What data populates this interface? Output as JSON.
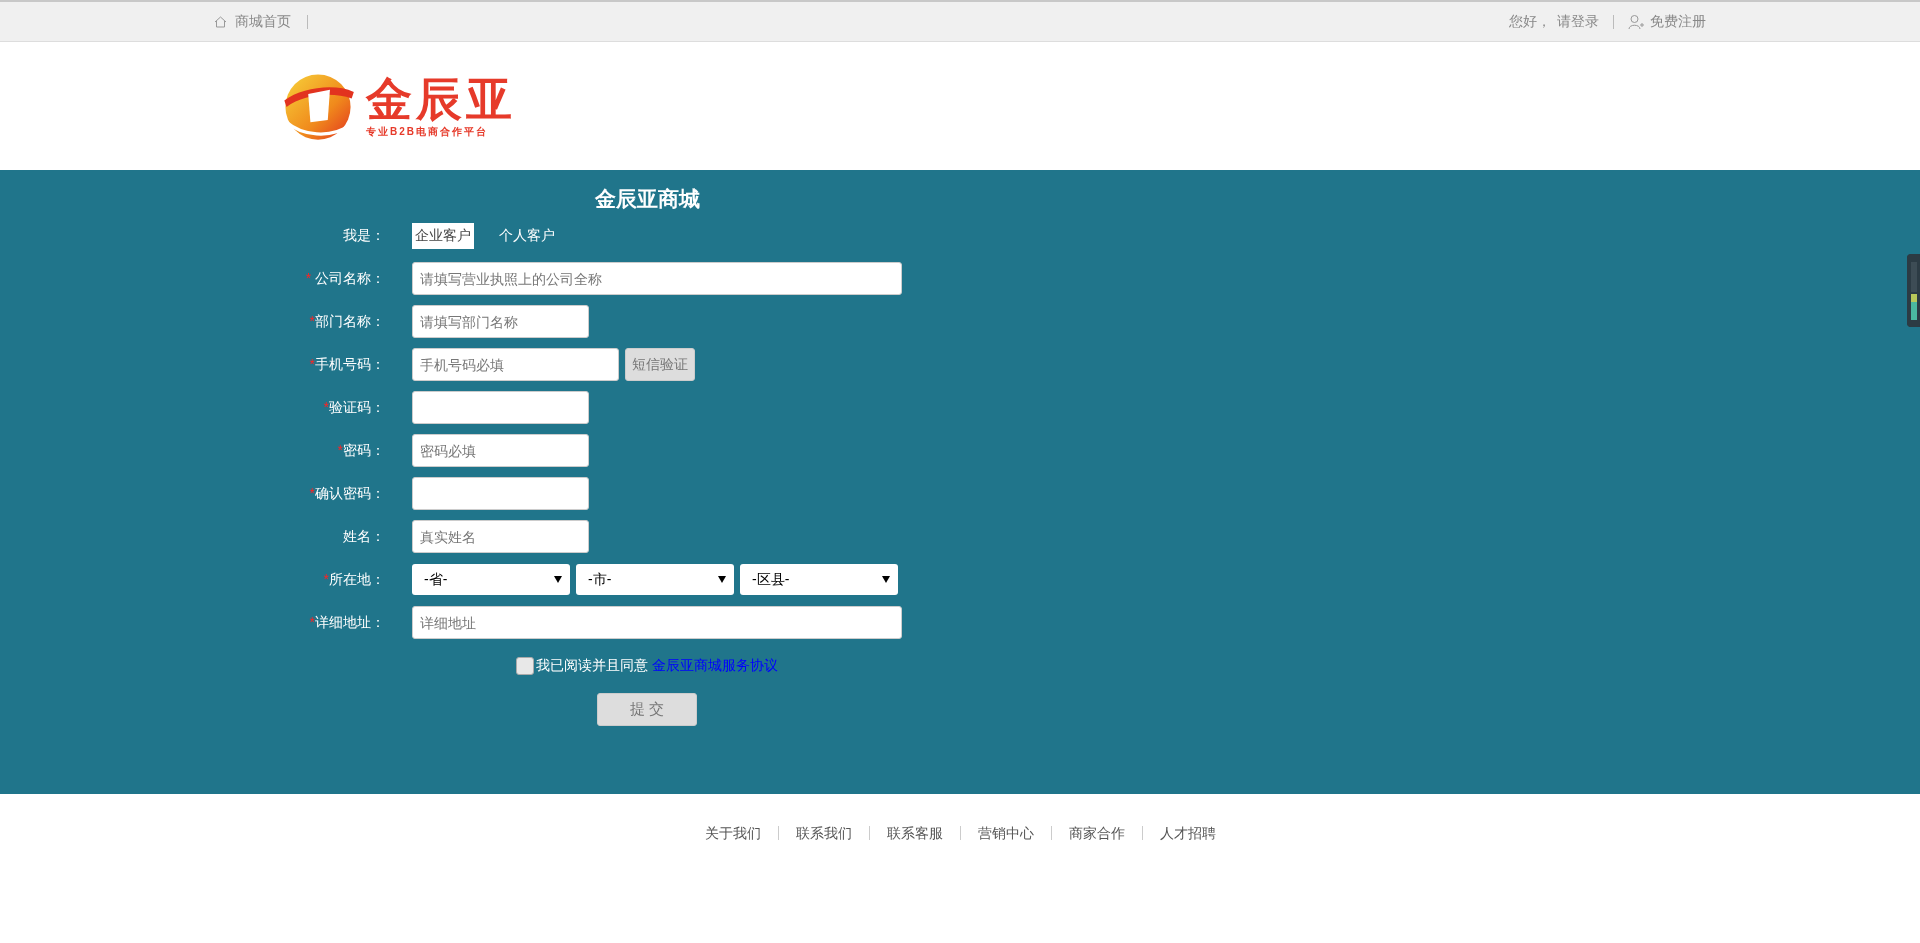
{
  "top_bar": {
    "home_link": "商城首页",
    "greeting": "您好，",
    "login_link": "请登录",
    "register_link": "免费注册"
  },
  "logo": {
    "name": "金辰亚",
    "tagline": "专业B2B电商合作平台"
  },
  "form": {
    "title": "金辰亚商城",
    "customer_type": {
      "label": "我是：",
      "options": [
        {
          "label": "企业客户",
          "selected": true
        },
        {
          "label": "个人客户",
          "selected": false
        }
      ]
    },
    "fields": [
      {
        "kind": "text_wide",
        "marker": "* ",
        "label": "公司名称：",
        "placeholder": "请填写营业执照上的公司全称"
      },
      {
        "kind": "text",
        "marker": "*",
        "label": "部门名称：",
        "placeholder": "请填写部门名称"
      },
      {
        "kind": "text_button",
        "marker": "*",
        "label": "手机号码：",
        "placeholder": "手机号码必填",
        "button": "短信验证"
      },
      {
        "kind": "text",
        "marker": "*",
        "label": "验证码："
      },
      {
        "kind": "text",
        "marker": "*",
        "label": "密码：",
        "placeholder": "密码必填"
      },
      {
        "kind": "text",
        "marker": "*",
        "label": "确认密码："
      },
      {
        "kind": "text",
        "label": "姓名：",
        "placeholder": "真实姓名"
      },
      {
        "kind": "selects",
        "marker": "*",
        "label": "所在地：",
        "options": [
          "-省-",
          "-市-",
          "-区县-"
        ]
      },
      {
        "kind": "text_wide",
        "marker": "*",
        "label": "详细地址：",
        "placeholder": "详细地址"
      }
    ],
    "agreement": {
      "checked": false,
      "text": "我已阅读并且同意",
      "link": "金辰亚商城服务协议"
    },
    "submit": "提 交"
  },
  "footer": {
    "links": [
      "关于我们",
      "联系我们",
      "联系客服",
      "营销中心",
      "商家合作",
      "人才招聘"
    ]
  }
}
